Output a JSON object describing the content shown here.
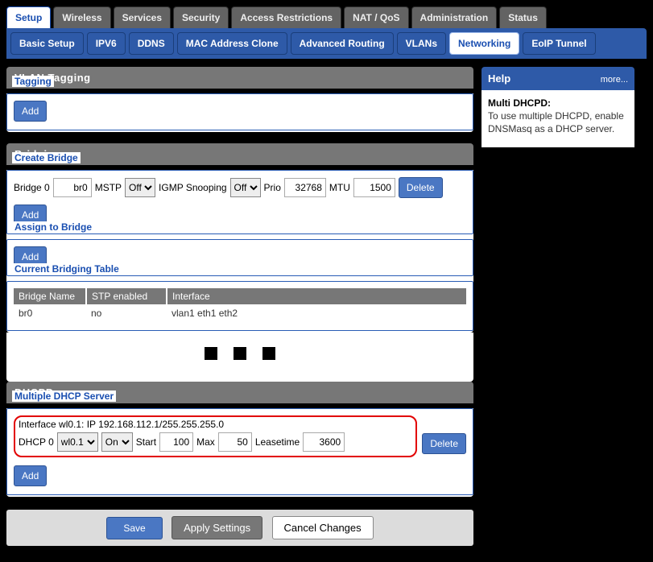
{
  "tabs_main": [
    "Setup",
    "Wireless",
    "Services",
    "Security",
    "Access Restrictions",
    "NAT / QoS",
    "Administration",
    "Status"
  ],
  "tabs_main_active": 0,
  "subtabs": [
    "Basic Setup",
    "IPV6",
    "DDNS",
    "MAC Address Clone",
    "Advanced Routing",
    "VLANs",
    "Networking",
    "EoIP Tunnel"
  ],
  "subtabs_active": 6,
  "vlan": {
    "heading": "VLAN Tagging",
    "tagging_title": "Tagging",
    "add": "Add"
  },
  "bridging": {
    "heading": "Bridging",
    "create_title": "Create Bridge",
    "row": {
      "label": "Bridge 0",
      "name": "br0",
      "mstp_label": "MSTP",
      "mstp": "Off",
      "igmp_label": "IGMP Snooping",
      "igmp": "Off",
      "prio_label": "Prio",
      "prio": "32768",
      "mtu_label": "MTU",
      "mtu": "1500",
      "delete": "Delete"
    },
    "add": "Add",
    "assign_title": "Assign to Bridge",
    "table_title": "Current Bridging Table",
    "table_headers": [
      "Bridge Name",
      "STP enabled",
      "Interface"
    ],
    "table_row": [
      "br0",
      "no",
      "vlan1 eth1 eth2"
    ]
  },
  "dhcpd": {
    "heading": "DHCPD",
    "section_title": "Multiple DHCP Server",
    "iface_line": "Interface wl0.1: IP 192.168.112.1/255.255.255.0",
    "row": {
      "label": "DHCP 0",
      "iface": "wl0.1",
      "state": "On",
      "start_label": "Start",
      "start": "100",
      "max_label": "Max",
      "max": "50",
      "lease_label": "Leasetime",
      "lease": "3600",
      "delete": "Delete"
    },
    "add": "Add"
  },
  "actions": {
    "save": "Save",
    "apply": "Apply Settings",
    "cancel": "Cancel Changes"
  },
  "help": {
    "title": "Help",
    "more": "more...",
    "subject": "Multi DHCPD:",
    "body": "To use multiple DHCPD, enable DNSMasq as a DHCP server."
  }
}
